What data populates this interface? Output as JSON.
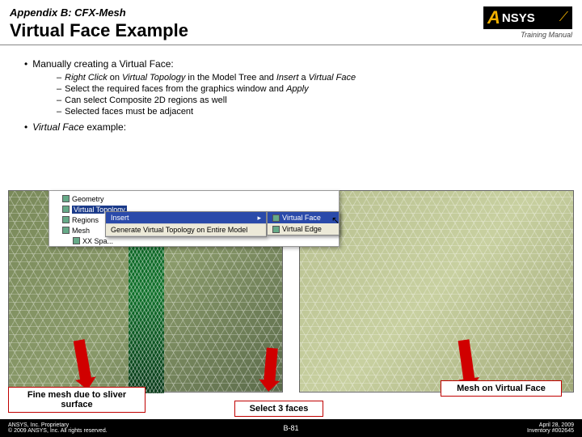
{
  "header": {
    "appendix": "Appendix B: CFX-Mesh",
    "title": "Virtual Face Example",
    "logo_letter": "A",
    "logo_text": "NSYS",
    "training": "Training Manual"
  },
  "content": {
    "b1": "Manually creating a Virtual Face:",
    "sub1_a": "Right Click ",
    "sub1_b": "on ",
    "sub1_c": "Virtual Topology ",
    "sub1_d": "in the Model Tree ",
    "sub1_e": "and ",
    "sub1_f": "Insert ",
    "sub1_g": "a ",
    "sub1_h": "Virtual Face",
    "sub2": "Select the required faces from the graphics window and ",
    "sub2_b": "Apply",
    "sub3": "Can select Composite 2D regions as well",
    "sub4": "Selected faces must be adjacent",
    "b2": "Virtual Face ",
    "b2_b": "example:"
  },
  "tree": {
    "r1": "Geometry",
    "r2": "Virtual Topology",
    "r3": "Regions",
    "r4": "Mesh",
    "r5": "XX Spa..."
  },
  "menu": {
    "m1": "Insert",
    "m2": "Generate Virtual Topology on Entire Model"
  },
  "submenu": {
    "s1": "Virtual Face",
    "s2": "Virtual Edge"
  },
  "labels": {
    "fine": "Fine mesh due to sliver surface",
    "select": "Select 3 faces",
    "mesh": "Mesh on Virtual Face"
  },
  "footer": {
    "left1": "ANSYS, Inc. Proprietary",
    "left2": "© 2009 ANSYS, Inc. All rights reserved.",
    "center": "B-81",
    "right1": "April 28, 2009",
    "right2": "Inventory #002645"
  }
}
